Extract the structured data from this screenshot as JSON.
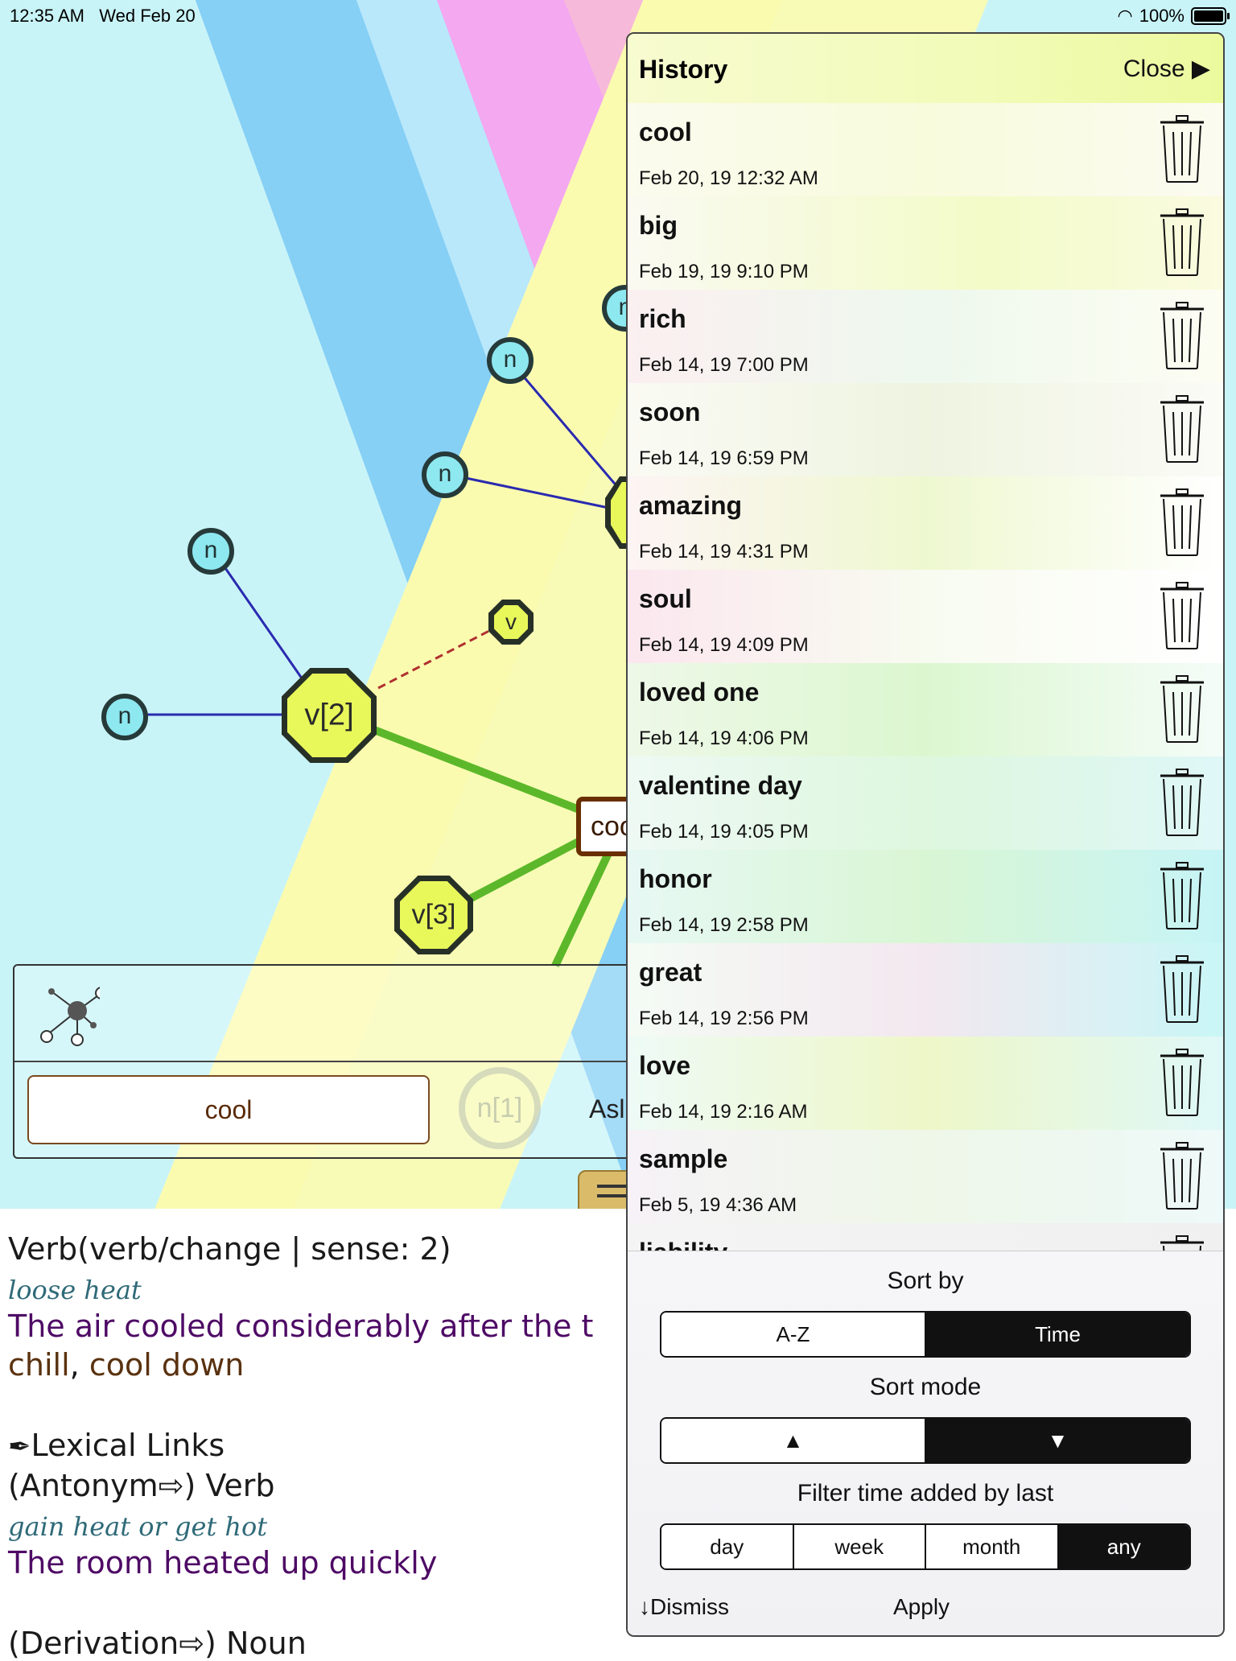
{
  "status_bar": {
    "time": "12:35 AM",
    "date": "Wed Feb 20",
    "battery": "100%"
  },
  "graph": {
    "center_label": "coo",
    "nodes_n": [
      "n",
      "n",
      "n",
      "n",
      "n"
    ],
    "node_v2": "v[2]",
    "node_v3": "v[3]",
    "node_v_small": "v",
    "faded_node": "n[1]"
  },
  "toolbar": {
    "search_value": "cool",
    "ask_label": "Asl"
  },
  "definition": {
    "heading": "Verb(verb/change | sense: 2)",
    "gloss": "loose heat",
    "example": "The air cooled considerably after the t",
    "synonyms": [
      "chill",
      "cool down"
    ],
    "lexical_links_title": "Lexical Links",
    "antonym_line": "(Antonym⇨) Verb",
    "antonym_gloss": "gain heat or get hot",
    "antonym_example": "The room heated up quickly",
    "derivation_line": "(Derivation⇨) Noun"
  },
  "history": {
    "title": "History",
    "close_label": "Close ▶",
    "items": [
      {
        "word": "cool",
        "date": "Feb 20, 19 12:32 AM"
      },
      {
        "word": "big",
        "date": "Feb 19, 19 9:10 PM"
      },
      {
        "word": "rich",
        "date": "Feb 14, 19 7:00 PM"
      },
      {
        "word": "soon",
        "date": "Feb 14, 19 6:59 PM"
      },
      {
        "word": "amazing",
        "date": "Feb 14, 19 4:31 PM"
      },
      {
        "word": "soul",
        "date": "Feb 14, 19 4:09 PM"
      },
      {
        "word": "loved one",
        "date": "Feb 14, 19 4:06 PM"
      },
      {
        "word": "valentine day",
        "date": "Feb 14, 19 4:05 PM"
      },
      {
        "word": "honor",
        "date": "Feb 14, 19 2:58 PM"
      },
      {
        "word": "great",
        "date": "Feb 14, 19 2:56 PM"
      },
      {
        "word": "love",
        "date": "Feb 14, 19 2:16 AM"
      },
      {
        "word": "sample",
        "date": "Feb 5, 19 4:36 AM"
      },
      {
        "word": "liability",
        "date": ""
      }
    ],
    "sort_by_label": "Sort by",
    "sort_by_options": [
      "A-Z",
      "Time"
    ],
    "sort_by_selected": "Time",
    "sort_mode_label": "Sort mode",
    "sort_mode_options": [
      "▲",
      "▼"
    ],
    "sort_mode_selected": "▼",
    "filter_label": "Filter time added by last",
    "filter_options": [
      "day",
      "week",
      "month",
      "any"
    ],
    "filter_selected": "any",
    "dismiss_label": "↓Dismiss",
    "apply_label": "Apply"
  }
}
